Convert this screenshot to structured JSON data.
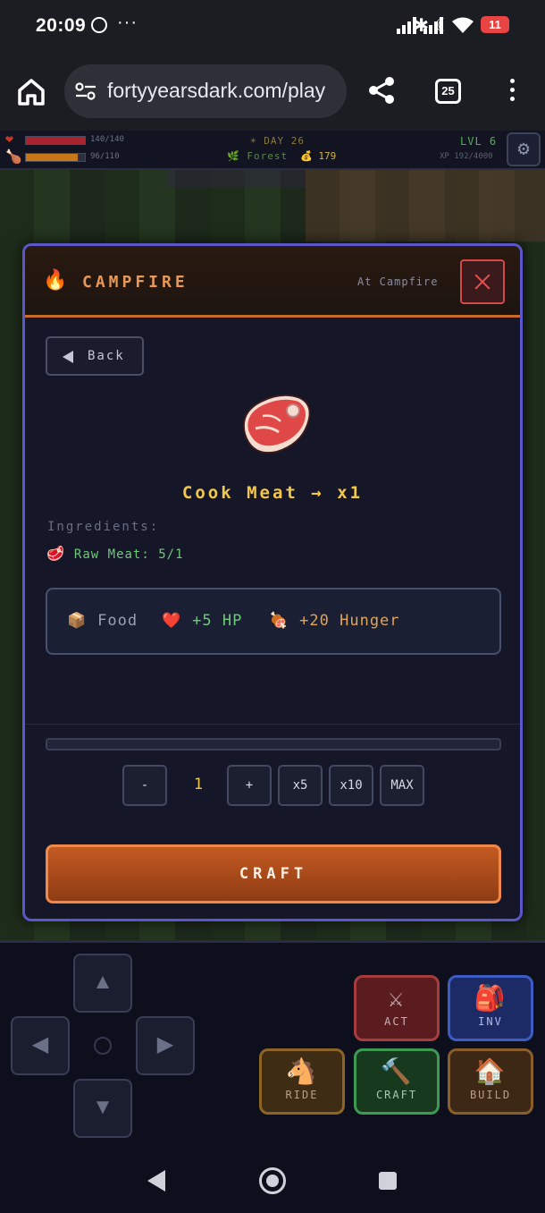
{
  "status_bar": {
    "time": "20:09",
    "battery": "11",
    "icons": [
      "whatsapp-icon",
      "more-icon",
      "bluetooth-icon",
      "moon-icon",
      "mute-icon",
      "signal-icon",
      "signal-icon",
      "wifi-icon",
      "battery-icon"
    ]
  },
  "browser": {
    "url": "fortyyearsdark.com/play",
    "tab_count": "25"
  },
  "hud": {
    "hp_text": "140/140",
    "hp_fraction": 1.0,
    "food_text": "96/110",
    "food_fraction": 0.873,
    "day": "DAY 26",
    "biome": "Forest",
    "gold": "179",
    "level": "LVL 6",
    "xp": "XP 192/4000"
  },
  "modal": {
    "title": "CAMPFIRE",
    "location": "At Campfire",
    "back_label": "Back",
    "recipe_title": "Cook Meat  →  x1",
    "ingredients_label": "Ingredients:",
    "ingredients": [
      {
        "icon": "🥩",
        "text": "Raw Meat: 5/1"
      }
    ],
    "effects": {
      "category_icon": "📦",
      "category": "Food",
      "hp_icon": "❤️",
      "hp": "+5 HP",
      "hunger_icon": "🍖",
      "hunger": "+20 Hunger"
    },
    "progress_fraction": 0,
    "quantity": {
      "minus": "-",
      "value": "1",
      "plus": "+",
      "x5": "x5",
      "x10": "x10",
      "max": "MAX"
    },
    "craft_label": "CRAFT"
  },
  "controls": {
    "dpad": {
      "up": "▲",
      "left": "◀",
      "right": "▶",
      "down": "▼"
    },
    "act": {
      "icon": "⚔",
      "label": "ACT"
    },
    "inv": {
      "icon": "🎒",
      "label": "INV"
    },
    "ride": {
      "icon": "🐴",
      "label": "RIDE"
    },
    "craft": {
      "icon": "🔨",
      "label": "CRAFT"
    },
    "build": {
      "icon": "🏠",
      "label": "BUILD"
    }
  },
  "colors": {
    "modal_border": "#5b57c8",
    "accent_orange": "#c76a2a",
    "title_gold": "#f2c84a",
    "ingredient_green": "#6fc97a",
    "close_red": "#d44848"
  }
}
